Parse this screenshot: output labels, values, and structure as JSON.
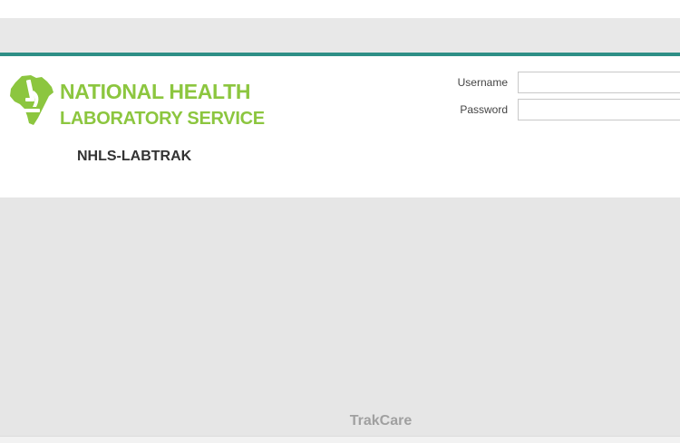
{
  "header": {
    "org_name_line1": "NATIONAL HEALTH",
    "org_name_line2": "LABORATORY SERVICE",
    "system_name": "NHLS-LABTRAK",
    "logo_icon": "africa-microscope-logo-icon"
  },
  "login": {
    "username_label": "Username",
    "username_value": "",
    "password_label": "Password",
    "password_value": ""
  },
  "footer": {
    "brand": "TrakCare"
  },
  "colors": {
    "accent_rule": "#2e8f86",
    "brand_green": "#8cc63f",
    "band_gray": "#e8e8e8",
    "content_gray": "#e6e6e6"
  }
}
